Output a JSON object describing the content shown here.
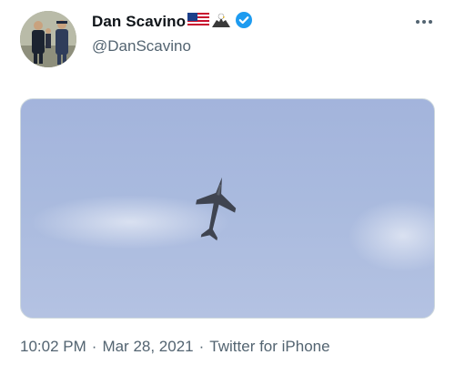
{
  "tweet": {
    "author": {
      "display_name": "Dan Scavino",
      "handle": "@DanScavino",
      "verified": true,
      "name_emojis": [
        "flag-us-icon",
        "eagle-icon"
      ]
    },
    "timestamp_time": "10:02 PM",
    "timestamp_date": "Mar 28, 2021",
    "separator": "·",
    "source": "Twitter for iPhone",
    "media": {
      "type": "image",
      "description_icon": "fighter-jet-in-sky"
    },
    "colors": {
      "verified": "#1d9bf0",
      "secondary_text": "#536471",
      "sky": "#a9bade"
    }
  }
}
